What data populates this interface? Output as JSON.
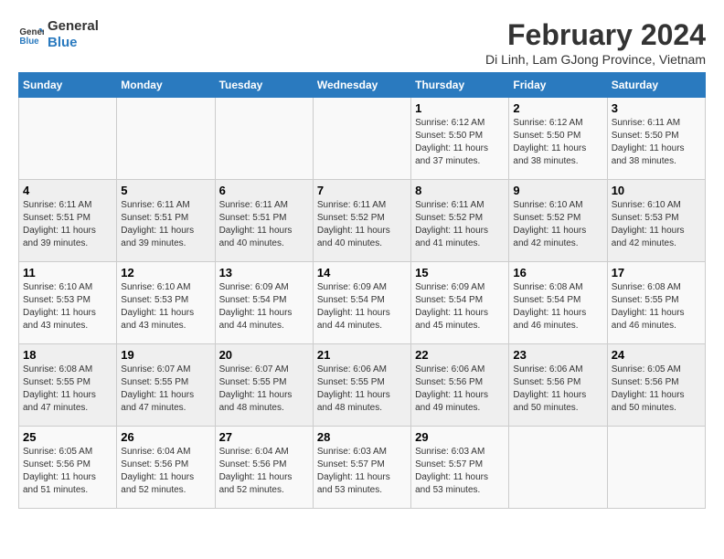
{
  "logo": {
    "text_general": "General",
    "text_blue": "Blue"
  },
  "title": "February 2024",
  "subtitle": "Di Linh, Lam GJong Province, Vietnam",
  "headers": [
    "Sunday",
    "Monday",
    "Tuesday",
    "Wednesday",
    "Thursday",
    "Friday",
    "Saturday"
  ],
  "weeks": [
    [
      {
        "day": "",
        "info": ""
      },
      {
        "day": "",
        "info": ""
      },
      {
        "day": "",
        "info": ""
      },
      {
        "day": "",
        "info": ""
      },
      {
        "day": "1",
        "info": "Sunrise: 6:12 AM\nSunset: 5:50 PM\nDaylight: 11 hours\nand 37 minutes."
      },
      {
        "day": "2",
        "info": "Sunrise: 6:12 AM\nSunset: 5:50 PM\nDaylight: 11 hours\nand 38 minutes."
      },
      {
        "day": "3",
        "info": "Sunrise: 6:11 AM\nSunset: 5:50 PM\nDaylight: 11 hours\nand 38 minutes."
      }
    ],
    [
      {
        "day": "4",
        "info": "Sunrise: 6:11 AM\nSunset: 5:51 PM\nDaylight: 11 hours\nand 39 minutes."
      },
      {
        "day": "5",
        "info": "Sunrise: 6:11 AM\nSunset: 5:51 PM\nDaylight: 11 hours\nand 39 minutes."
      },
      {
        "day": "6",
        "info": "Sunrise: 6:11 AM\nSunset: 5:51 PM\nDaylight: 11 hours\nand 40 minutes."
      },
      {
        "day": "7",
        "info": "Sunrise: 6:11 AM\nSunset: 5:52 PM\nDaylight: 11 hours\nand 40 minutes."
      },
      {
        "day": "8",
        "info": "Sunrise: 6:11 AM\nSunset: 5:52 PM\nDaylight: 11 hours\nand 41 minutes."
      },
      {
        "day": "9",
        "info": "Sunrise: 6:10 AM\nSunset: 5:52 PM\nDaylight: 11 hours\nand 42 minutes."
      },
      {
        "day": "10",
        "info": "Sunrise: 6:10 AM\nSunset: 5:53 PM\nDaylight: 11 hours\nand 42 minutes."
      }
    ],
    [
      {
        "day": "11",
        "info": "Sunrise: 6:10 AM\nSunset: 5:53 PM\nDaylight: 11 hours\nand 43 minutes."
      },
      {
        "day": "12",
        "info": "Sunrise: 6:10 AM\nSunset: 5:53 PM\nDaylight: 11 hours\nand 43 minutes."
      },
      {
        "day": "13",
        "info": "Sunrise: 6:09 AM\nSunset: 5:54 PM\nDaylight: 11 hours\nand 44 minutes."
      },
      {
        "day": "14",
        "info": "Sunrise: 6:09 AM\nSunset: 5:54 PM\nDaylight: 11 hours\nand 44 minutes."
      },
      {
        "day": "15",
        "info": "Sunrise: 6:09 AM\nSunset: 5:54 PM\nDaylight: 11 hours\nand 45 minutes."
      },
      {
        "day": "16",
        "info": "Sunrise: 6:08 AM\nSunset: 5:54 PM\nDaylight: 11 hours\nand 46 minutes."
      },
      {
        "day": "17",
        "info": "Sunrise: 6:08 AM\nSunset: 5:55 PM\nDaylight: 11 hours\nand 46 minutes."
      }
    ],
    [
      {
        "day": "18",
        "info": "Sunrise: 6:08 AM\nSunset: 5:55 PM\nDaylight: 11 hours\nand 47 minutes."
      },
      {
        "day": "19",
        "info": "Sunrise: 6:07 AM\nSunset: 5:55 PM\nDaylight: 11 hours\nand 47 minutes."
      },
      {
        "day": "20",
        "info": "Sunrise: 6:07 AM\nSunset: 5:55 PM\nDaylight: 11 hours\nand 48 minutes."
      },
      {
        "day": "21",
        "info": "Sunrise: 6:06 AM\nSunset: 5:55 PM\nDaylight: 11 hours\nand 48 minutes."
      },
      {
        "day": "22",
        "info": "Sunrise: 6:06 AM\nSunset: 5:56 PM\nDaylight: 11 hours\nand 49 minutes."
      },
      {
        "day": "23",
        "info": "Sunrise: 6:06 AM\nSunset: 5:56 PM\nDaylight: 11 hours\nand 50 minutes."
      },
      {
        "day": "24",
        "info": "Sunrise: 6:05 AM\nSunset: 5:56 PM\nDaylight: 11 hours\nand 50 minutes."
      }
    ],
    [
      {
        "day": "25",
        "info": "Sunrise: 6:05 AM\nSunset: 5:56 PM\nDaylight: 11 hours\nand 51 minutes."
      },
      {
        "day": "26",
        "info": "Sunrise: 6:04 AM\nSunset: 5:56 PM\nDaylight: 11 hours\nand 52 minutes."
      },
      {
        "day": "27",
        "info": "Sunrise: 6:04 AM\nSunset: 5:56 PM\nDaylight: 11 hours\nand 52 minutes."
      },
      {
        "day": "28",
        "info": "Sunrise: 6:03 AM\nSunset: 5:57 PM\nDaylight: 11 hours\nand 53 minutes."
      },
      {
        "day": "29",
        "info": "Sunrise: 6:03 AM\nSunset: 5:57 PM\nDaylight: 11 hours\nand 53 minutes."
      },
      {
        "day": "",
        "info": ""
      },
      {
        "day": "",
        "info": ""
      }
    ]
  ]
}
